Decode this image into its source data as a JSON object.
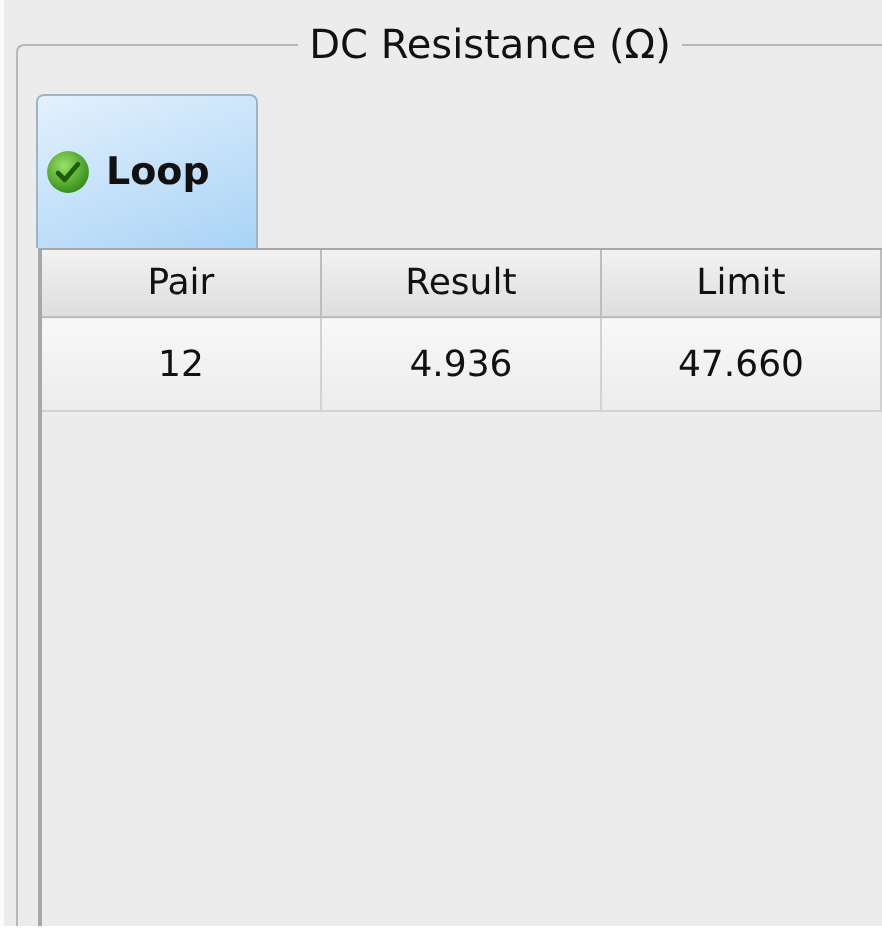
{
  "group": {
    "title": "DC Resistance (Ω)"
  },
  "tabs": [
    {
      "label": "Loop",
      "selected": true,
      "passed": true
    }
  ],
  "table": {
    "columns": [
      "Pair",
      "Result",
      "Limit"
    ],
    "rows": [
      [
        "12",
        "4.936",
        "47.660"
      ]
    ]
  }
}
